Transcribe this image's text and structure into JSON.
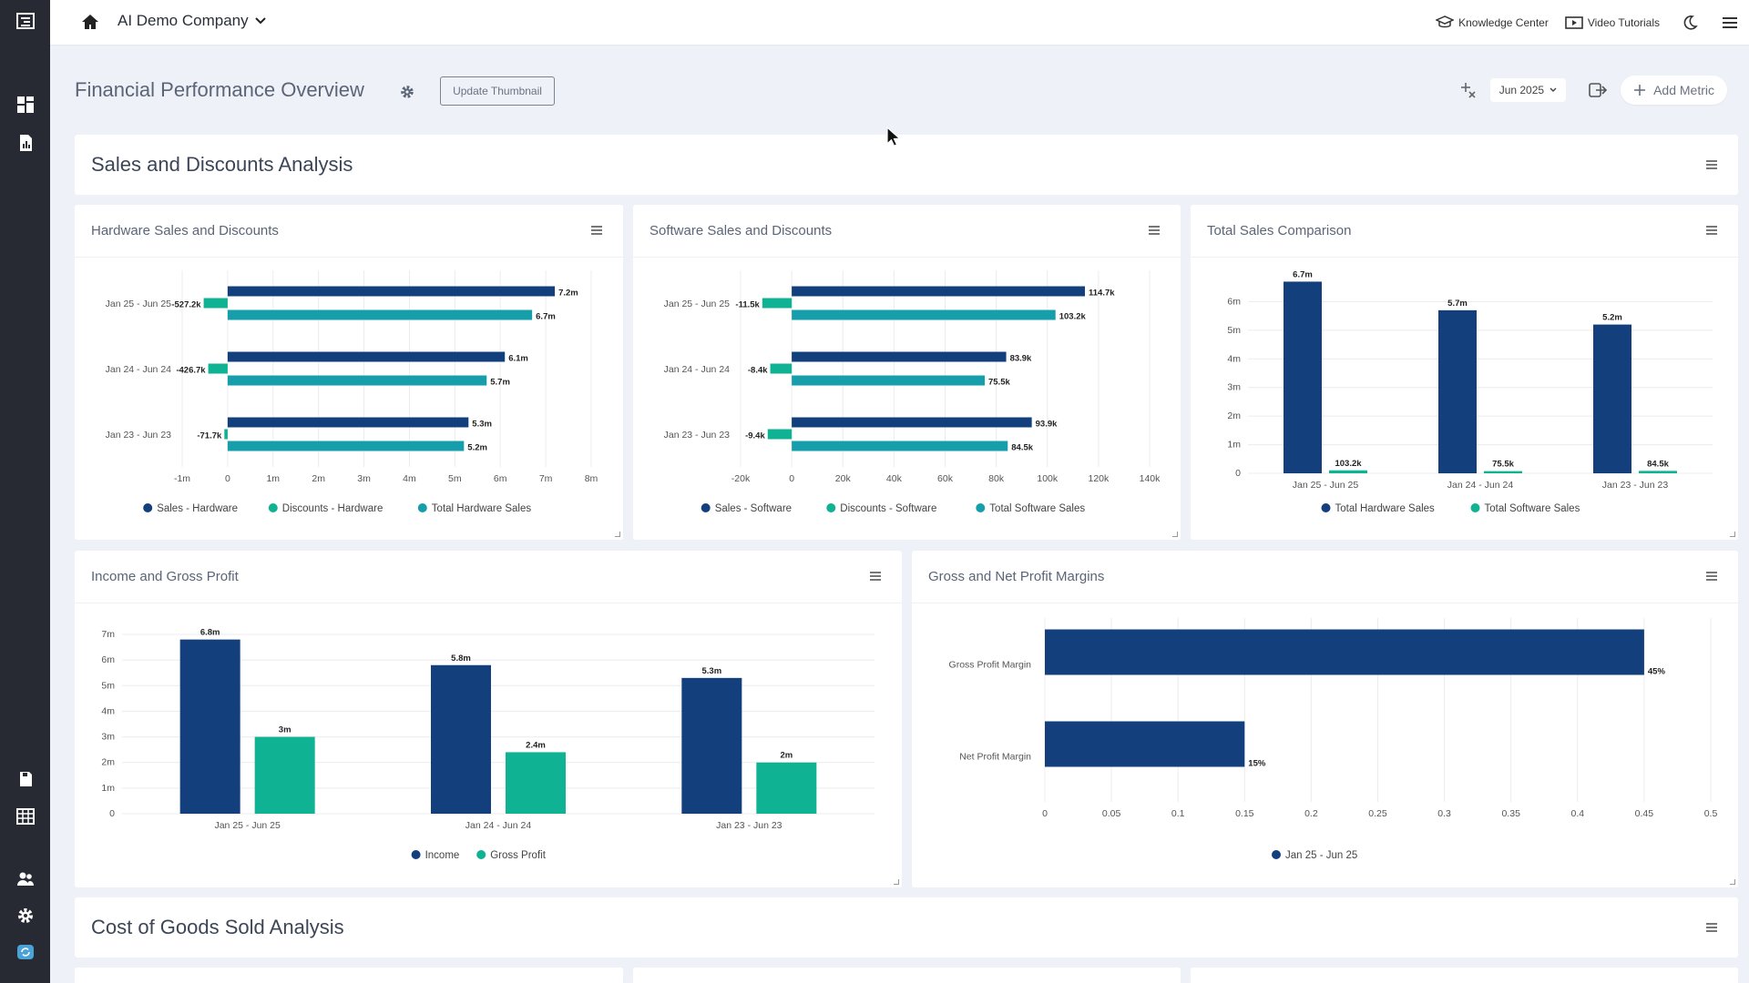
{
  "nav": {
    "company": "AI Demo Company",
    "knowledge_center": "Knowledge Center",
    "video_tutorials": "Video Tutorials"
  },
  "header": {
    "title": "Financial Performance Overview",
    "update_thumbnail": "Update Thumbnail",
    "date_filter": "Jun 2025",
    "add_metric": "Add Metric"
  },
  "sections": {
    "sales_discounts": "Sales and Discounts Analysis",
    "cogs": "Cost of Goods Sold Analysis"
  },
  "colors": {
    "primary": "#133f7c",
    "secondary": "#0fb293",
    "tertiary": "#169eab",
    "rail": "#272a33"
  },
  "cards": [
    {
      "title": "Hardware Sales and Discounts"
    },
    {
      "title": "Software Sales and Discounts"
    },
    {
      "title": "Total Sales Comparison"
    },
    {
      "title": "Income and Gross Profit"
    },
    {
      "title": "Gross and Net Profit Margins"
    }
  ],
  "chart_data": [
    {
      "type": "bar",
      "orientation": "horizontal",
      "title": "Hardware Sales and Discounts",
      "categories": [
        "Jan 25 - Jun 25",
        "Jan 24 - Jun 24",
        "Jan 23 - Jun 23"
      ],
      "series": [
        {
          "name": "Sales - Hardware",
          "values": [
            7200000,
            6100000,
            5300000
          ],
          "labels": [
            "7.2m",
            "6.1m",
            "5.3m"
          ]
        },
        {
          "name": "Discounts - Hardware",
          "values": [
            -527200,
            -426700,
            -71700
          ],
          "labels": [
            "-527.2k",
            "-426.7k",
            "-71.7k"
          ]
        },
        {
          "name": "Total Hardware Sales",
          "values": [
            6700000,
            5700000,
            5200000
          ],
          "labels": [
            "6.7m",
            "5.7m",
            "5.2m"
          ]
        }
      ],
      "xlim": [
        -1000000,
        8000000
      ],
      "xticks": [
        -1000000,
        0,
        1000000,
        2000000,
        3000000,
        4000000,
        5000000,
        6000000,
        7000000,
        8000000
      ],
      "xtick_labels": [
        "-1m",
        "0",
        "1m",
        "2m",
        "3m",
        "4m",
        "5m",
        "6m",
        "7m",
        "8m"
      ]
    },
    {
      "type": "bar",
      "orientation": "horizontal",
      "title": "Software Sales and Discounts",
      "categories": [
        "Jan 25 - Jun 25",
        "Jan 24 - Jun 24",
        "Jan 23 - Jun 23"
      ],
      "series": [
        {
          "name": "Sales - Software",
          "values": [
            114700,
            83900,
            93900
          ],
          "labels": [
            "114.7k",
            "83.9k",
            "93.9k"
          ]
        },
        {
          "name": "Discounts - Software",
          "values": [
            -11500,
            -8400,
            -9400
          ],
          "labels": [
            "-11.5k",
            "-8.4k",
            "-9.4k"
          ]
        },
        {
          "name": "Total Software Sales",
          "values": [
            103200,
            75500,
            84500
          ],
          "labels": [
            "103.2k",
            "75.5k",
            "84.5k"
          ]
        }
      ],
      "xlim": [
        -20000,
        140000
      ],
      "xticks": [
        -20000,
        0,
        20000,
        40000,
        60000,
        80000,
        100000,
        120000,
        140000
      ],
      "xtick_labels": [
        "-20k",
        "0",
        "20k",
        "40k",
        "60k",
        "80k",
        "100k",
        "120k",
        "140k"
      ]
    },
    {
      "type": "bar",
      "title": "Total Sales Comparison",
      "categories": [
        "Jan 25 - Jun 25",
        "Jan 24 - Jun 24",
        "Jan 23 - Jun 23"
      ],
      "series": [
        {
          "name": "Total Hardware Sales",
          "values": [
            6700000,
            5700000,
            5200000
          ],
          "labels": [
            "6.7m",
            "5.7m",
            "5.2m"
          ]
        },
        {
          "name": "Total Software Sales",
          "values": [
            103200,
            75500,
            84500
          ],
          "labels": [
            "103.2k",
            "75.5k",
            "84.5k"
          ]
        }
      ],
      "ylim": [
        0,
        7000000
      ],
      "yticks": [
        0,
        1000000,
        2000000,
        3000000,
        4000000,
        5000000,
        6000000
      ],
      "ytick_labels": [
        "0",
        "1m",
        "2m",
        "3m",
        "4m",
        "5m",
        "6m"
      ]
    },
    {
      "type": "bar",
      "title": "Income and Gross Profit",
      "categories": [
        "Jan 25 - Jun 25",
        "Jan 24 - Jun 24",
        "Jan 23 - Jun 23"
      ],
      "series": [
        {
          "name": "Income",
          "values": [
            6800000,
            5800000,
            5300000
          ],
          "labels": [
            "6.8m",
            "5.8m",
            "5.3m"
          ]
        },
        {
          "name": "Gross Profit",
          "values": [
            3000000,
            2400000,
            2000000
          ],
          "labels": [
            "3m",
            "2.4m",
            "2m"
          ]
        }
      ],
      "ylim": [
        0,
        7000000
      ],
      "yticks": [
        0,
        1000000,
        2000000,
        3000000,
        4000000,
        5000000,
        6000000,
        7000000
      ],
      "ytick_labels": [
        "0",
        "1m",
        "2m",
        "3m",
        "4m",
        "5m",
        "6m",
        "7m"
      ]
    },
    {
      "type": "bar",
      "orientation": "horizontal",
      "title": "Gross and Net Profit Margins",
      "categories": [
        "Gross Profit Margin",
        "Net Profit Margin"
      ],
      "series": [
        {
          "name": "Jan 25 - Jun 25",
          "values": [
            0.45,
            0.15
          ],
          "labels": [
            "45%",
            "15%"
          ]
        }
      ],
      "xlim": [
        0,
        0.5
      ],
      "xticks": [
        0,
        0.05,
        0.1,
        0.15,
        0.2,
        0.25,
        0.3,
        0.35,
        0.4,
        0.45,
        0.5
      ],
      "xtick_labels": [
        "0",
        "0.05",
        "0.1",
        "0.15",
        "0.2",
        "0.25",
        "0.3",
        "0.35",
        "0.4",
        "0.45",
        "0.5"
      ]
    }
  ]
}
